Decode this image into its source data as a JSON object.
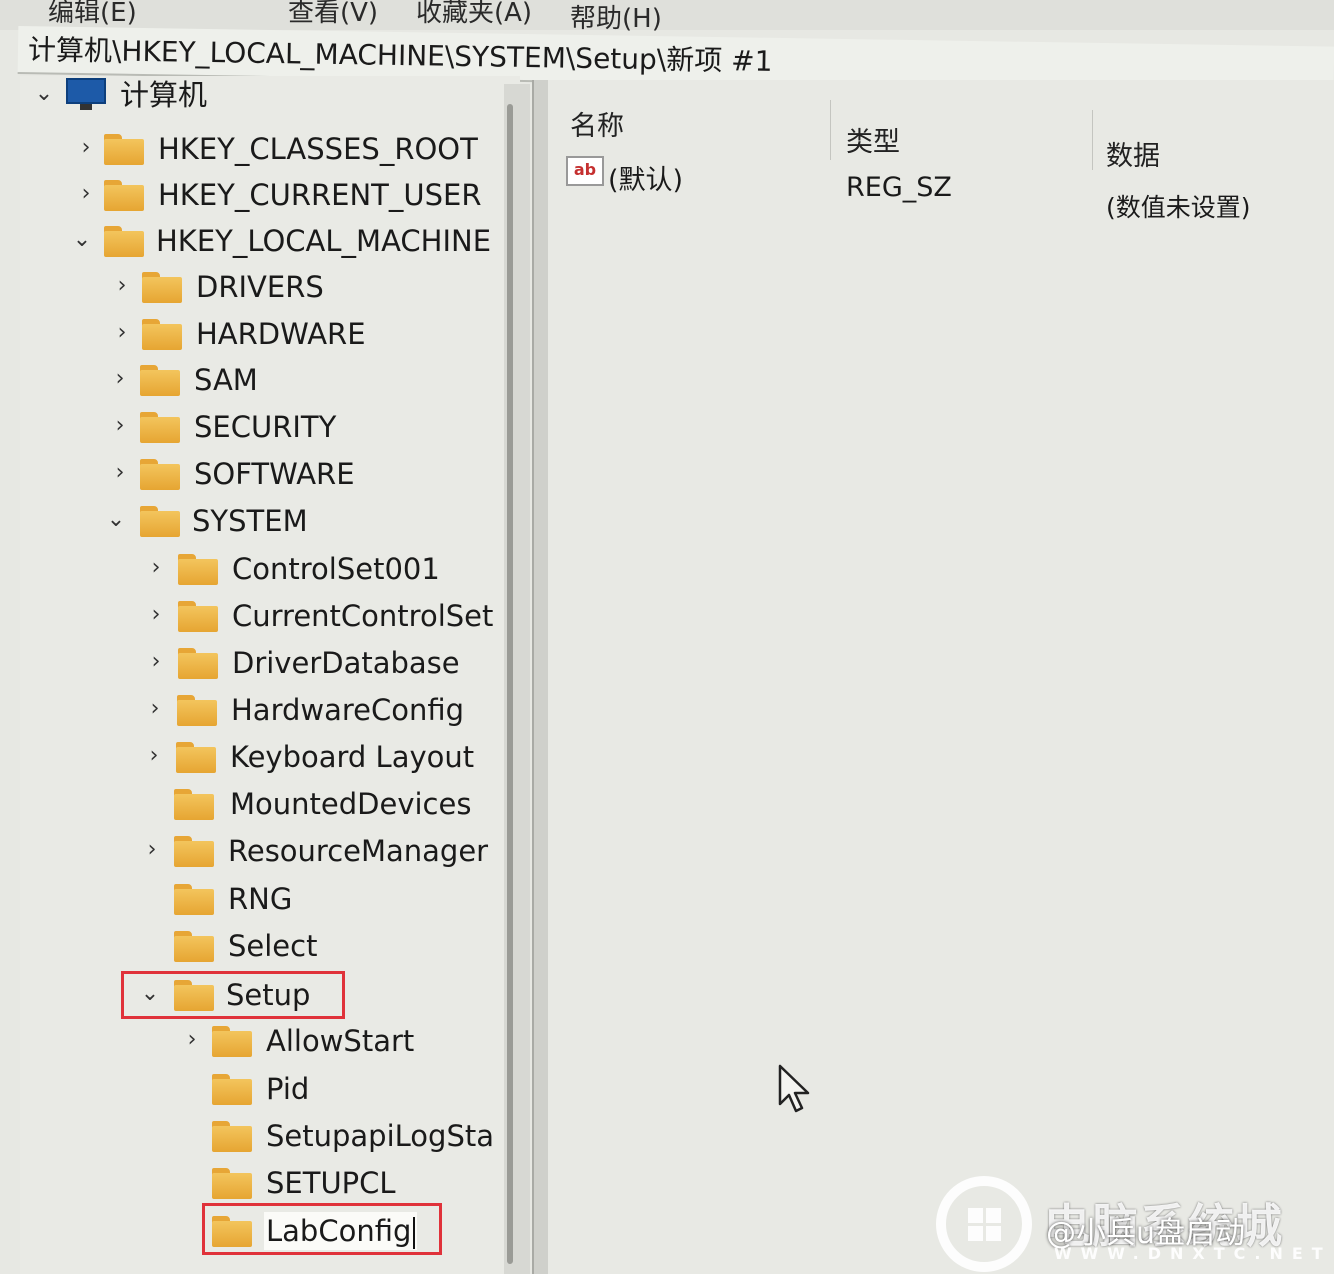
{
  "menubar": {
    "items": [
      "编辑(E)",
      "查看(V)",
      "收藏夹(A)",
      "帮助(H)"
    ]
  },
  "address": "计算机\\HKEY_LOCAL_MACHINE\\SYSTEM\\Setup\\新项 #1",
  "tree": {
    "root": "计算机",
    "hives": [
      "HKEY_CLASSES_ROOT",
      "HKEY_CURRENT_USER",
      "HKEY_LOCAL_MACHINE"
    ],
    "hklm_children": [
      "DRIVERS",
      "HARDWARE",
      "SAM",
      "SECURITY",
      "SOFTWARE",
      "SYSTEM"
    ],
    "system_children": [
      "ControlSet001",
      "CurrentControlSet",
      "DriverDatabase",
      "HardwareConfig",
      "Keyboard Layout",
      "MountedDevices",
      "ResourceManager",
      "RNG",
      "Select",
      "Setup"
    ],
    "setup_children": [
      "AllowStart",
      "Pid",
      "SetupapiLogSta",
      "SETUPCL"
    ],
    "new_key_value": "LabConfig"
  },
  "values_pane": {
    "headers": {
      "name": "名称",
      "type": "类型",
      "data": "数据"
    },
    "rows": [
      {
        "icon": "ab",
        "name": "(默认)",
        "type": "REG_SZ",
        "data": "(数值未设置)"
      }
    ]
  },
  "watermark": {
    "brand": "电脑系统城",
    "handle": "@小兵u盘启动",
    "url": "WWW.DNXTC.NET"
  },
  "colors": {
    "folder": "#f3c55d",
    "highlight_box": "#e0323a",
    "computer_icon": "#1d5aa8"
  }
}
